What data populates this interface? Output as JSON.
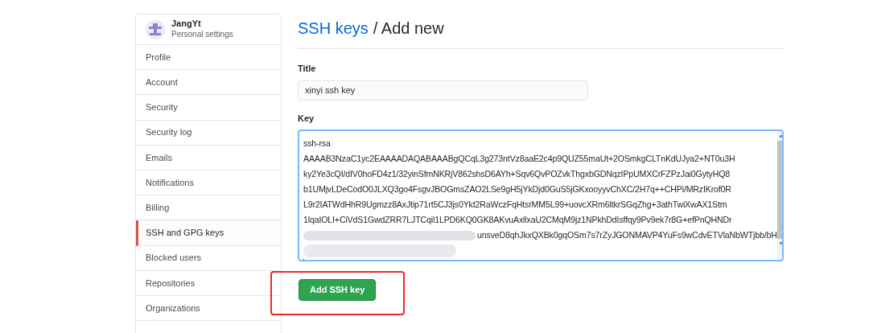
{
  "sidebar": {
    "user": {
      "name": "JangYt",
      "subtitle": "Personal settings"
    },
    "items": [
      {
        "label": "Profile",
        "selected": false
      },
      {
        "label": "Account",
        "selected": false
      },
      {
        "label": "Security",
        "selected": false
      },
      {
        "label": "Security log",
        "selected": false
      },
      {
        "label": "Emails",
        "selected": false
      },
      {
        "label": "Notifications",
        "selected": false
      },
      {
        "label": "Billing",
        "selected": false
      },
      {
        "label": "SSH and GPG keys",
        "selected": true
      },
      {
        "label": "Blocked users",
        "selected": false
      },
      {
        "label": "Repositories",
        "selected": false
      },
      {
        "label": "Organizations",
        "selected": false
      }
    ]
  },
  "heading": {
    "link": "SSH keys",
    "rest": "/ Add new"
  },
  "form": {
    "title_label": "Title",
    "title_value": "xinyi ssh key",
    "key_label": "Key",
    "key_lines": [
      "ssh-rsa",
      "AAAAB3NzaC1yc2EAAAADAQABAAABgQCqL3g273ntVz8aaE2c4p9QUZ55maUt+2OSmkgCLTnKdUJya2+NT0u3H",
      "ky2Ye3cQI/dIV0hoFD4z1/32yinSfmNKRjV862shsD6AYh+Sqv6QvPOZvkThgxbGDNqzIPpUMXCrFZPzJai0GytyHQ8",
      "b1UMjvLDeCodO0JLXQ3go4FsgvJBOGmsZAO2LSe9gH5jYkDjd0GuS5jGKxooyyvChXC/2H7q++CHPi/MRzIKrof0R",
      "L9r2IATWdHhR9Ugmzz8AxJtip71rt5CJ3js0Ykt2RaWczFqHtsrMM5L99+uovcXRm6ltkrSGqZhg+3athTwiXwAX1Stm",
      "1lqaIOLI+CiVdS1GwdZRR7LJTCqil1LPD6KQ0GK8AKvuAxllxaU2CMqM9jz1NPkhDdIsffqy9Pv9ek7r8G+efPnQHNDr"
    ],
    "key_partly_hidden_line": "unsveD8qhJkxQXBk0gqOSm7s7rZyJGONMAVP4YuFs9wCdvETVlaNbWTjbb/bH",
    "submit": "Add SSH key"
  }
}
